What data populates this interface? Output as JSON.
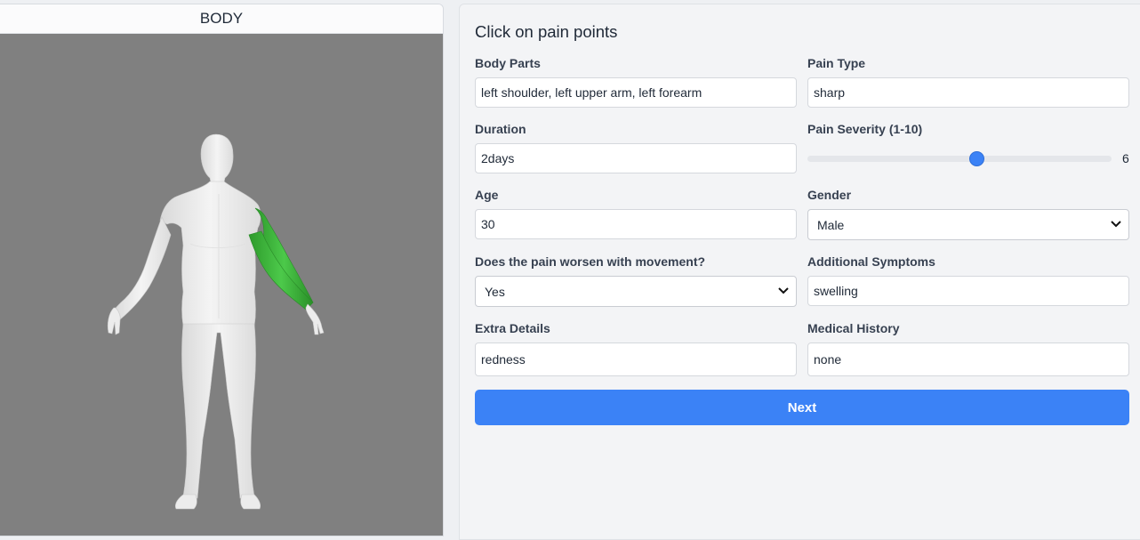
{
  "left_panel": {
    "title": "BODY"
  },
  "form": {
    "title": "Click on pain points",
    "body_parts": {
      "label": "Body Parts",
      "value": "left shoulder, left upper arm, left forearm"
    },
    "pain_type": {
      "label": "Pain Type",
      "value": "sharp"
    },
    "duration": {
      "label": "Duration",
      "value": "2days"
    },
    "pain_severity": {
      "label": "Pain Severity (1-10)",
      "value": "6",
      "min": 1,
      "max": 10,
      "level": 6
    },
    "age": {
      "label": "Age",
      "value": "30"
    },
    "gender": {
      "label": "Gender",
      "selected": "Male"
    },
    "movement": {
      "label": "Does the pain worsen with movement?",
      "selected": "Yes"
    },
    "additional_symptoms": {
      "label": "Additional Symptoms",
      "value": "swelling"
    },
    "extra_details": {
      "label": "Extra Details",
      "value": "redness"
    },
    "medical_history": {
      "label": "Medical History",
      "value": "none"
    },
    "next_label": "Next"
  },
  "colors": {
    "accent": "#3b82f6",
    "highlight": "#3db83a",
    "viewer_bg": "#808080",
    "body": "#efefef"
  },
  "icons": {
    "select": "chevron-down-icon"
  }
}
